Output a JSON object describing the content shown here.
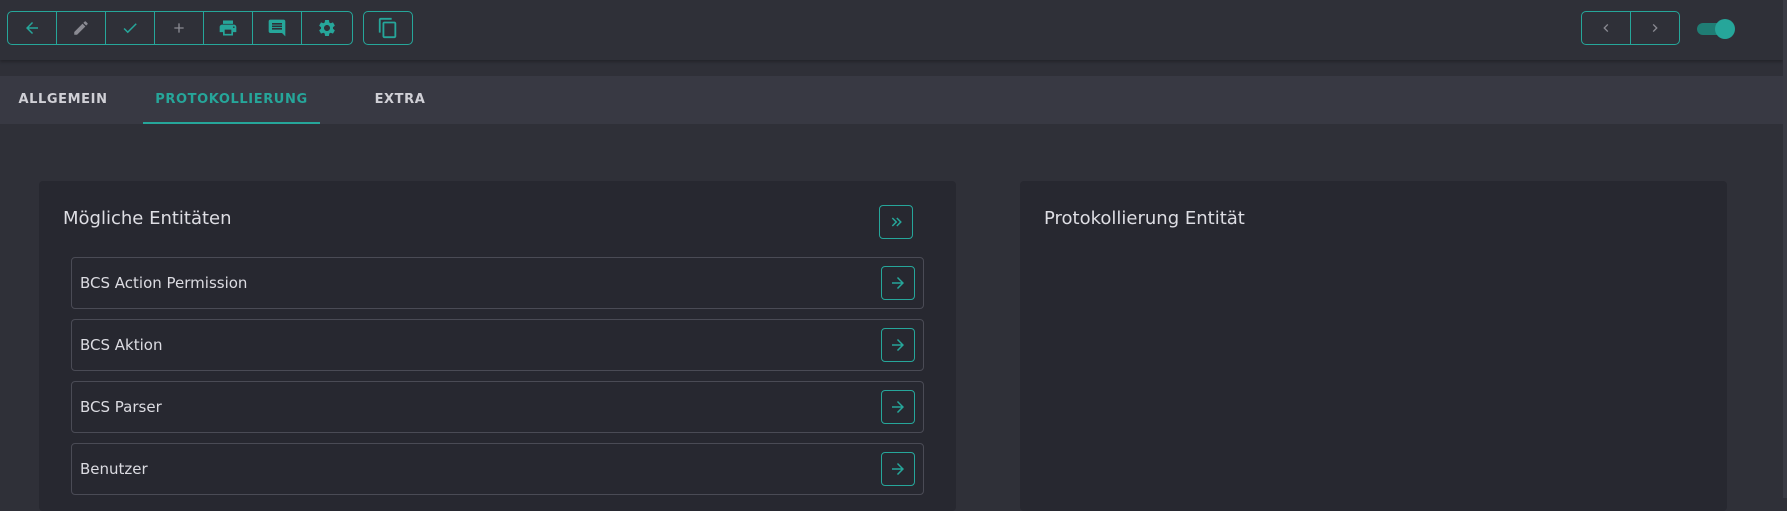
{
  "toolbar": {
    "main_buttons": [
      {
        "icon": "arrow-left-icon",
        "label": "back"
      },
      {
        "icon": "pencil-icon",
        "label": "edit"
      },
      {
        "icon": "check-icon",
        "label": "save"
      },
      {
        "icon": "plus-icon",
        "label": "add"
      },
      {
        "icon": "printer-icon",
        "label": "print"
      },
      {
        "icon": "comment-icon",
        "label": "comment"
      },
      {
        "icon": "gear-icon",
        "label": "settings"
      }
    ],
    "copy_button": {
      "icon": "copy-icon"
    },
    "nav_buttons": [
      {
        "icon": "chevron-left-icon"
      },
      {
        "icon": "chevron-right-icon"
      }
    ],
    "toggle": {
      "state": "on"
    }
  },
  "tabs": [
    {
      "label": "ALLGEMEIN",
      "active": false
    },
    {
      "label": "PROTOKOLLIERUNG",
      "active": true
    },
    {
      "label": "EXTRA",
      "active": false
    }
  ],
  "left_panel": {
    "title": "Mögliche Entitäten",
    "move_all_icon": "double-chevron-right-icon",
    "items": [
      {
        "label": "BCS Action Permission",
        "icon": "arrow-right-icon"
      },
      {
        "label": "BCS Aktion",
        "icon": "arrow-right-icon"
      },
      {
        "label": "BCS Parser",
        "icon": "arrow-right-icon"
      },
      {
        "label": "Benutzer",
        "icon": "arrow-right-icon"
      }
    ]
  },
  "right_panel": {
    "title": "Protokollierung Entität"
  },
  "colors": {
    "accent": "#26a69a",
    "background": "#2f3038",
    "panel": "#272830",
    "tabs_bar": "#383943",
    "disabled_icon": "#8a8a92"
  }
}
